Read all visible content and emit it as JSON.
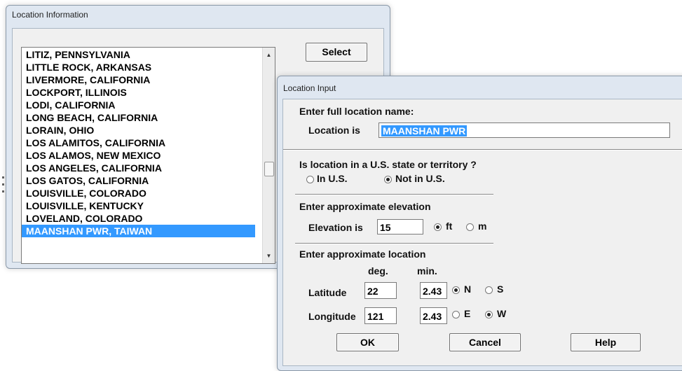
{
  "location_info": {
    "title": "Location Information",
    "select_label": "Select",
    "items": [
      "LITIZ, PENNSYLVANIA",
      "LITTLE ROCK, ARKANSAS",
      "LIVERMORE, CALIFORNIA",
      "LOCKPORT, ILLINOIS",
      "LODI, CALIFORNIA",
      "LONG BEACH, CALIFORNIA",
      "LORAIN, OHIO",
      "LOS ALAMITOS, CALIFORNIA",
      "LOS ALAMOS, NEW MEXICO",
      "LOS ANGELES, CALIFORNIA",
      "LOS GATOS, CALIFORNIA",
      "LOUISVILLE, COLORADO",
      "LOUISVILLE, KENTUCKY",
      "LOVELAND, COLORADO",
      "MAANSHAN PWR, TAIWAN"
    ],
    "selected_index": 14
  },
  "location_input": {
    "title": "Location Input",
    "name_prompt": "Enter full location name:",
    "location_label": "Location is",
    "location_value": "MAANSHAN PWR",
    "us_prompt": "Is location in a U.S. state or territory ?",
    "in_us": "In U.S.",
    "not_in_us": "Not in U.S.",
    "us_selected": "not_in_us",
    "elev_prompt": "Enter approximate elevation",
    "elev_label": "Elevation is",
    "elev_value": "15",
    "unit_ft": "ft",
    "unit_m": "m",
    "unit_selected": "ft",
    "loc_prompt": "Enter approximate location",
    "deg_label": "deg.",
    "min_label": "min.",
    "lat_label": "Latitude",
    "lat_deg": "22",
    "lat_min": "2.43",
    "lat_n": "N",
    "lat_s": "S",
    "lat_selected": "N",
    "lon_label": "Longitude",
    "lon_deg": "121",
    "lon_min": "2.43",
    "lon_e": "E",
    "lon_w": "W",
    "lon_selected": "W",
    "ok_label": "OK",
    "cancel_label": "Cancel",
    "help_label": "Help"
  }
}
